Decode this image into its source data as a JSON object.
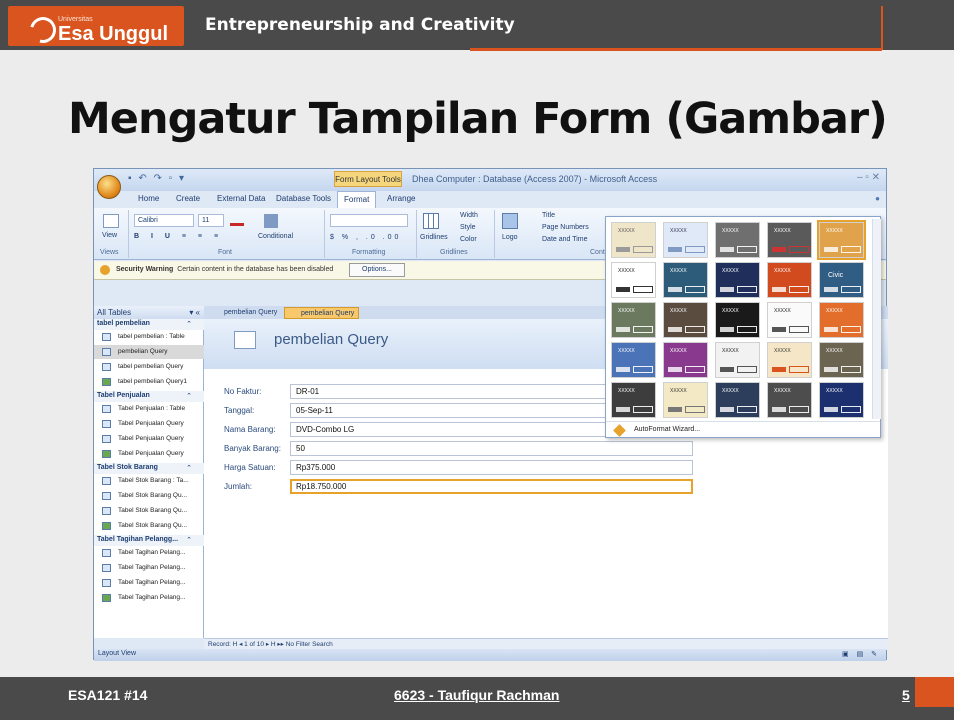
{
  "header": {
    "logo_small": "Universitas",
    "logo_text": "Esa Unggul",
    "title": "Entrepreneurship and Creativity"
  },
  "slide": {
    "title": "Mengatur  Tampilan Form (Gambar)"
  },
  "access": {
    "context_tab": "Form Layout Tools",
    "window_title": "Dhea Computer : Database (Access 2007) - Microsoft Access",
    "tabs": [
      "Home",
      "Create",
      "External Data",
      "Database Tools",
      "Format",
      "Arrange"
    ],
    "active_tab": "Format",
    "ribbon": {
      "view_label": "View",
      "font_name": "Calibri",
      "font_size": "11",
      "conditional_label": "Conditional",
      "gridlines_label": "Gridlines",
      "width_label": "Width",
      "style_label": "Style",
      "color_label": "Color",
      "logo_label": "Logo",
      "title_label": "Title",
      "page_numbers_label": "Page Numbers",
      "date_time_label": "Date and Time",
      "groups": [
        "Views",
        "Font",
        "Formatting",
        "Gridlines",
        "Contr"
      ]
    },
    "security": {
      "title": "Security Warning",
      "message": "Certain content in the database has been disabled",
      "options_button": "Options..."
    },
    "nav": {
      "header": "All Tables",
      "groups": [
        {
          "name": "tabel pembelian",
          "items": [
            "tabel pembelian : Table",
            "pembelian Query",
            "tabel pembelian Query",
            "tabel pembelian Query1"
          ]
        },
        {
          "name": "Tabel Penjualan",
          "items": [
            "Tabel Penjualan : Table",
            "Tabel Penjualan Query",
            "Tabel Penjualan Query",
            "Tabel Penjualan Query"
          ]
        },
        {
          "name": "Tabel Stok Barang",
          "items": [
            "Tabel Stok Barang : Ta...",
            "Tabel Stok Barang Qu...",
            "Tabel Stok Barang Qu...",
            "Tabel Stok Barang Qu..."
          ]
        },
        {
          "name": "Tabel Tagihan Pelangg...",
          "items": [
            "Tabel Tagihan Pelang...",
            "Tabel Tagihan Pelang...",
            "Tabel Tagihan Pelang...",
            "Tabel Tagihan Pelang..."
          ]
        }
      ]
    },
    "doc_tabs": [
      "pembelian Query",
      "pembelian Query"
    ],
    "form": {
      "title": "pembelian Query",
      "fields": [
        {
          "label": "No Faktur:",
          "value": "DR-01"
        },
        {
          "label": "Tanggal:",
          "value": "05-Sep-11"
        },
        {
          "label": "Nama Barang:",
          "value": "DVD-Combo LG"
        },
        {
          "label": "Banyak Barang:",
          "value": "50"
        },
        {
          "label": "Harga Satuan:",
          "value": "Rp375.000"
        },
        {
          "label": "Jumlah:",
          "value": "Rp18.750.000"
        }
      ]
    },
    "record_bar": "Record: H  ◂  1 of 10  ▸  H  ▸▸   No Filter    Search",
    "status": "Layout View",
    "gallery": {
      "selected_theme": "Civic",
      "thumb_text": "XXXXX",
      "autoformat": "AutoFormat Wizard..."
    }
  },
  "footer": {
    "course": "ESA121 #14",
    "author": "6623 - Taufiqur Rachman",
    "page": "5"
  },
  "colors": {
    "accent": "#d9541e",
    "dark_bar": "#4a4a4a",
    "highlight": "#e6a22a"
  }
}
